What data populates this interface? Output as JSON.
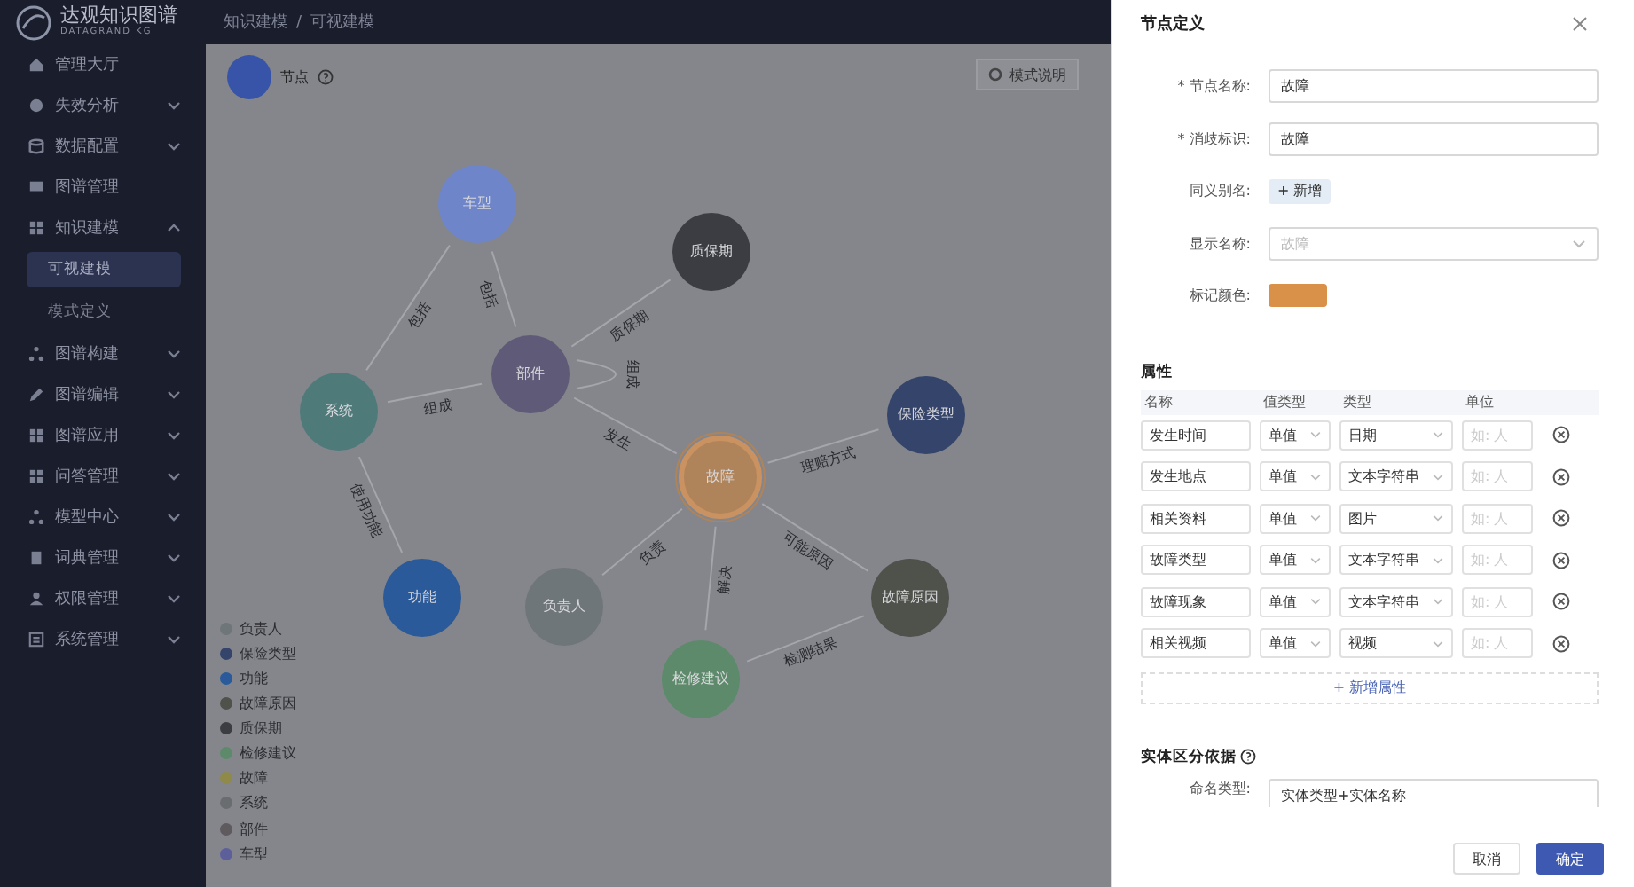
{
  "logo": {
    "name": "达观知识图谱",
    "subtitle": "DATAGRAND KG"
  },
  "breadcrumb": {
    "items": [
      "知识建模",
      "可视建模"
    ],
    "separator": "/"
  },
  "sidebar": {
    "items": [
      {
        "label": "管理大厅",
        "kind": "leaf"
      },
      {
        "label": "失效分析",
        "kind": "group",
        "expanded": false
      },
      {
        "label": "数据配置",
        "kind": "group",
        "expanded": false
      },
      {
        "label": "图谱管理",
        "kind": "leaf"
      },
      {
        "label": "知识建模",
        "kind": "group",
        "expanded": true,
        "children": [
          {
            "label": "可视建模",
            "selected": true
          },
          {
            "label": "模式定义",
            "selected": false
          }
        ]
      },
      {
        "label": "图谱构建",
        "kind": "group",
        "expanded": false
      },
      {
        "label": "图谱编辑",
        "kind": "group",
        "expanded": false
      },
      {
        "label": "图谱应用",
        "kind": "group",
        "expanded": false
      },
      {
        "label": "问答管理",
        "kind": "group",
        "expanded": false
      },
      {
        "label": "模型中心",
        "kind": "group",
        "expanded": false
      },
      {
        "label": "词典管理",
        "kind": "group",
        "expanded": false
      },
      {
        "label": "权限管理",
        "kind": "group",
        "expanded": false
      },
      {
        "label": "系统管理",
        "kind": "group",
        "expanded": false
      }
    ]
  },
  "canvas": {
    "node_legend": "节点",
    "mode_button": "模式说明",
    "nodes": [
      {
        "label": "车型",
        "color": "#6f85c9",
        "selected": false
      },
      {
        "label": "质保期",
        "color": "#3c3d42",
        "selected": false
      },
      {
        "label": "部件",
        "color": "#5e5a78",
        "selected": false
      },
      {
        "label": "系统",
        "color": "#4f7a7a",
        "selected": false
      },
      {
        "label": "保险类型",
        "color": "#35446b",
        "selected": false
      },
      {
        "label": "故障",
        "color": "#b0845a",
        "selected": true
      },
      {
        "label": "功能",
        "color": "#2a5a99",
        "selected": false
      },
      {
        "label": "负责人",
        "color": "#6f7679",
        "selected": false
      },
      {
        "label": "故障原因",
        "color": "#4f524a",
        "selected": false
      },
      {
        "label": "检修建议",
        "color": "#5d8a6a",
        "selected": false
      }
    ],
    "edges": [
      {
        "label": "包括"
      },
      {
        "label": "包括"
      },
      {
        "label": "质保期"
      },
      {
        "label": "组成"
      },
      {
        "label": "组成"
      },
      {
        "label": "发生"
      },
      {
        "label": "理赔方式"
      },
      {
        "label": "使用功能"
      },
      {
        "label": "负责"
      },
      {
        "label": "解决"
      },
      {
        "label": "可能原因"
      },
      {
        "label": "检测结果"
      }
    ],
    "legend": [
      {
        "label": "负责人",
        "color": "#6f7679"
      },
      {
        "label": "保险类型",
        "color": "#35446b"
      },
      {
        "label": "功能",
        "color": "#2a5a99"
      },
      {
        "label": "故障原因",
        "color": "#4f524a"
      },
      {
        "label": "质保期",
        "color": "#3c3d42"
      },
      {
        "label": "检修建议",
        "color": "#5d8a6a"
      },
      {
        "label": "故障",
        "color": "#8f8a4a"
      },
      {
        "label": "系统",
        "color": "#6a6d70"
      },
      {
        "label": "部件",
        "color": "#5e5a5e"
      },
      {
        "label": "车型",
        "color": "#5d5f9a"
      }
    ]
  },
  "drawer": {
    "title": "节点定义",
    "fields": [
      {
        "kind": "input",
        "label": "* 节点名称:",
        "value": "故障"
      },
      {
        "kind": "input",
        "label": "* 消歧标识:",
        "value": "故障"
      },
      {
        "kind": "tag",
        "label": "同义别名:",
        "value": "+ 新增"
      },
      {
        "kind": "select",
        "label": "显示名称:",
        "placeholder": "故障"
      },
      {
        "kind": "color",
        "label": "标记颜色:",
        "color": "#d9914a"
      }
    ],
    "attributes_title": "属性",
    "columns": [
      "名称",
      "值类型",
      "类型",
      "单位"
    ],
    "rows": [
      {
        "name": "发生时间",
        "value_type": "单值",
        "type": "日期",
        "unit_placeholder": "如: 人"
      },
      {
        "name": "发生地点",
        "value_type": "单值",
        "type": "文本字符串",
        "unit_placeholder": "如: 人"
      },
      {
        "name": "相关资料",
        "value_type": "单值",
        "type": "图片",
        "unit_placeholder": "如: 人"
      },
      {
        "name": "故障类型",
        "value_type": "单值",
        "type": "文本字符串",
        "unit_placeholder": "如: 人"
      },
      {
        "name": "故障现象",
        "value_type": "单值",
        "type": "文本字符串",
        "unit_placeholder": "如: 人"
      },
      {
        "name": "相关视频",
        "value_type": "单值",
        "type": "视频",
        "unit_placeholder": "如: 人"
      }
    ],
    "add_attribute": "+ 新增属性",
    "basis_title": "实体区分依据",
    "basis_label": "命名类型:",
    "basis_value": "实体类型+实体名称",
    "buttons": [
      {
        "label": "取消",
        "primary": false
      },
      {
        "label": "确定",
        "primary": true
      }
    ]
  }
}
